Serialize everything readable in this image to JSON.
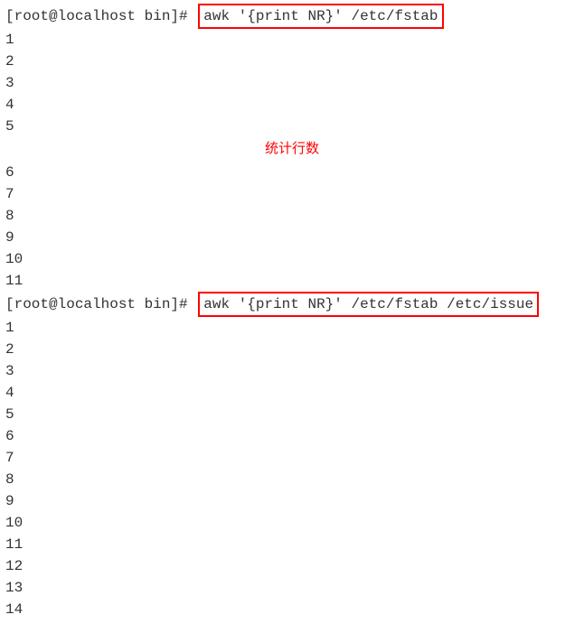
{
  "block1": {
    "prompt": "[root@localhost bin]#",
    "command": "awk '{print NR}' /etc/fstab",
    "output": [
      "1",
      "2",
      "3",
      "4",
      "5",
      "6",
      "7",
      "8",
      "9",
      "10",
      "11"
    ]
  },
  "annotation": "统计行数",
  "block2": {
    "prompt": "[root@localhost bin]#",
    "command": "awk '{print NR}' /etc/fstab /etc/issue",
    "output": [
      "1",
      "2",
      "3",
      "4",
      "5",
      "6",
      "7",
      "8",
      "9",
      "10",
      "11",
      "12",
      "13",
      "14"
    ]
  }
}
